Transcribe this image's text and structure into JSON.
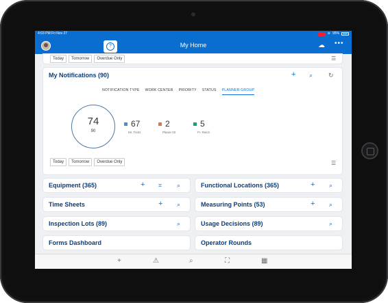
{
  "status_bar": {
    "time": "4:03 PM  Fri Nov 27",
    "battery": "95%"
  },
  "nav": {
    "title": "My Home",
    "help_icon": "question-circle-icon",
    "cloud_icon": "cloud-sync-icon",
    "more_icon": "more-icon"
  },
  "top_filters": [
    "Today",
    "Tomorrow",
    "Overdue Only"
  ],
  "notifications": {
    "title": "My Notifications (90)",
    "tabs": [
      "NOTIFICATION TYPE",
      "WORK CENTER",
      "PRIORITY",
      "STATUS",
      "PLANNER GROUP"
    ],
    "active_tab": "PLANNER GROUP",
    "total_value": "74",
    "total_sub": "90",
    "stats": [
      {
        "value": "67",
        "label": "Mr. Trintz",
        "color": "#4b8fd1"
      },
      {
        "value": "2",
        "label": "Planer 02",
        "color": "#e4753b"
      },
      {
        "value": "5",
        "label": "Fr. Reich",
        "color": "#1f9e74"
      }
    ],
    "filters": [
      "Today",
      "Tomorrow",
      "Overdue Only"
    ]
  },
  "tiles": {
    "equipment": "Equipment (365)",
    "functional_locations": "Functional Locations (365)",
    "time_sheets": "Time Sheets",
    "measuring_points": "Measuring Points (53)",
    "inspection_lots": "Inspection Lots (89)",
    "usage_decisions": "Usage Decisions (89)",
    "forms_dashboard": "Forms Dashboard",
    "operator_rounds": "Operator Rounds"
  },
  "bottom_toolbar": [
    "add-icon",
    "alert-icon",
    "search-icon",
    "map-icon",
    "grid-icon"
  ]
}
